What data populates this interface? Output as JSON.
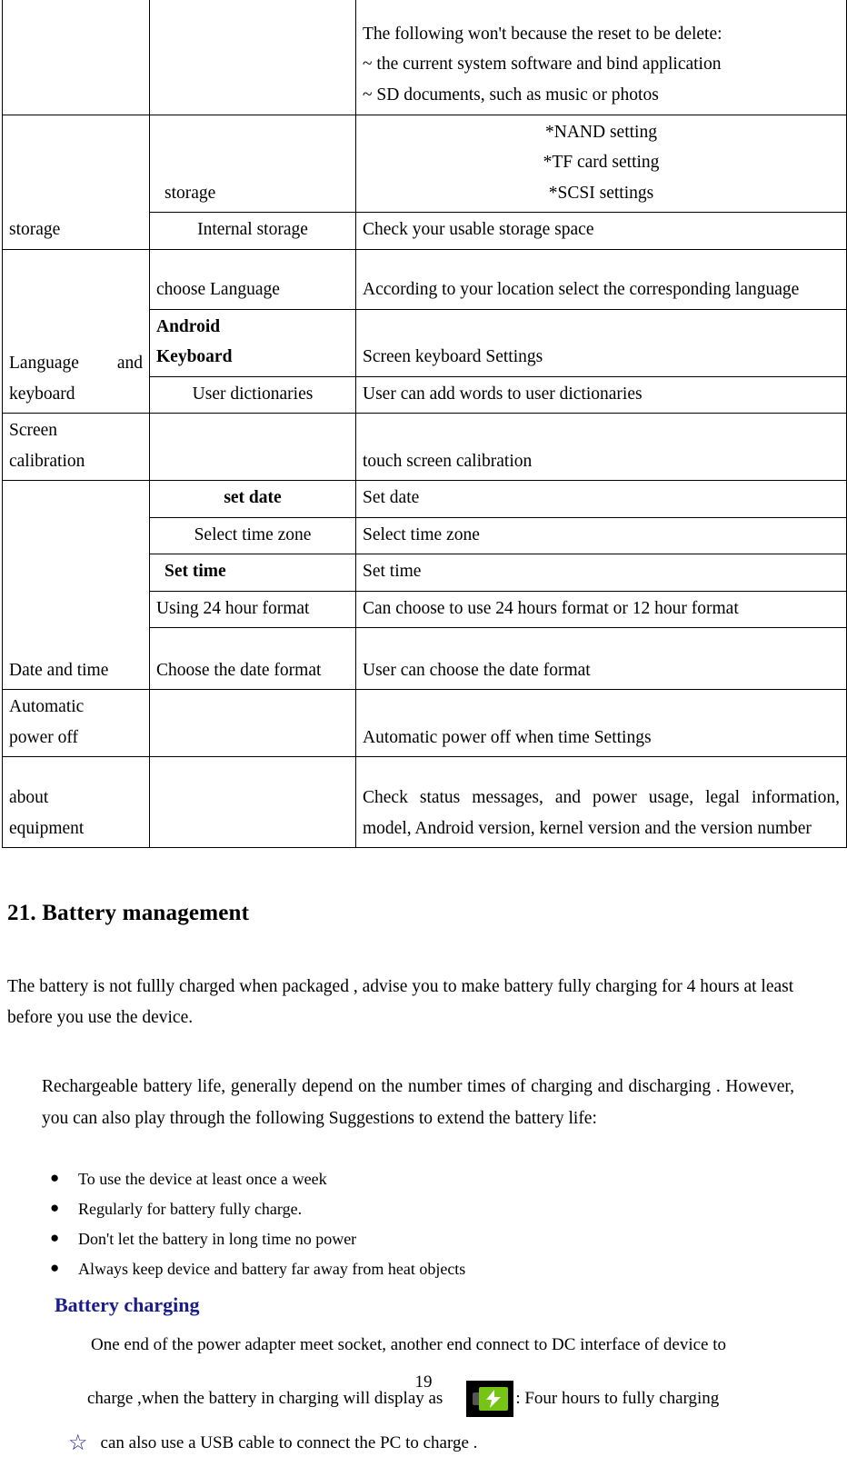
{
  "document": {
    "page_number": "19",
    "colors": {
      "heading_blue": "#1b1b8f",
      "battery_green": "#76c413",
      "text_black": "#000000"
    }
  },
  "settings_table": {
    "rows": [
      {
        "feature": "",
        "option": "",
        "description_lines": [
          "The following won't because the reset to be delete:",
          "~ the current system software and bind application",
          "~ SD documents, such as music or photos"
        ]
      },
      {
        "feature": "storage",
        "option": "storage",
        "description_lines": [
          "*NAND setting",
          "*TF card setting",
          "*SCSI settings"
        ]
      },
      {
        "feature": "",
        "option": "Internal storage",
        "description_lines": [
          "Check your usable storage space"
        ]
      },
      {
        "feature": "Language and keyboard",
        "option": "choose Language",
        "description_lines": [
          "According to your location select the corresponding language"
        ]
      },
      {
        "feature": "",
        "option": "Android Keyboard",
        "option_line_1": "Android",
        "option_line_2": "Keyboard",
        "description_lines": [
          "Screen keyboard Settings"
        ]
      },
      {
        "feature": "",
        "option": "User dictionaries",
        "description_lines": [
          "User can add words to user dictionaries"
        ]
      },
      {
        "feature": "Screen calibration",
        "feature_line_1": "Screen",
        "feature_line_2": "calibration",
        "option": "",
        "description_lines": [
          "touch screen calibration"
        ]
      },
      {
        "feature": "Date and time",
        "option": "set date",
        "description_lines": [
          "Set date"
        ]
      },
      {
        "feature": "",
        "option": "Select time zone",
        "description_lines": [
          "Select time zone"
        ]
      },
      {
        "feature": "",
        "option": "Set time",
        "description_lines": [
          "Set time"
        ]
      },
      {
        "feature": "",
        "option": "Using 24 hour format",
        "description_lines": [
          "Can choose to use 24 hours format or 12 hour format"
        ]
      },
      {
        "feature": "",
        "option": "Choose the date format",
        "description_lines": [
          "User can choose the date format"
        ]
      },
      {
        "feature": "Automatic power off",
        "feature_line_1": "Automatic",
        "feature_line_2": "power off",
        "option": "",
        "description_lines": [
          "Automatic power off when time Settings"
        ]
      },
      {
        "feature": "about equipment",
        "feature_line_1": "about",
        "feature_line_2": "equipment",
        "option": "",
        "description_lines": [
          "Check status messages, and power usage, legal information, model, Android version, kernel version and the version number"
        ]
      }
    ],
    "cells": {
      "r1_desc_l1": "The following won't because the reset to be delete:",
      "r1_desc_l2": "~ the current system software and bind application",
      "r1_desc_l3": "~ SD documents, such as music or photos",
      "r2_feature": "storage",
      "r2_option": "storage",
      "r2_desc_l1": "*NAND setting",
      "r2_desc_l2": "*TF card setting",
      "r2_desc_l3": "*SCSI settings",
      "r3_option": "Internal storage",
      "r3_desc": "Check your usable storage space",
      "r4_feature": "Language  and keyboard",
      "r4_option": "choose Language",
      "r4_desc": "According to your location select the corresponding language",
      "r5_option_l1": "Android",
      "r5_option_l2": "Keyboard",
      "r5_desc": "Screen keyboard Settings",
      "r6_option": "User dictionaries",
      "r6_desc": "User can add words to user dictionaries",
      "r7_feature_l1": "Screen",
      "r7_feature_l2": "calibration",
      "r7_desc": "touch screen calibration",
      "r8_feature": "Date and time",
      "r8_option": "set date",
      "r8_desc": "Set date",
      "r9_option": "Select time zone",
      "r9_desc": "Select time zone",
      "r10_option": "Set time",
      "r10_desc": "Set time",
      "r11_option": "Using 24 hour format",
      "r11_desc": "Can choose to use 24 hours format or 12 hour format",
      "r12_option": "Choose the date format",
      "r12_desc": "User can choose the date format",
      "r13_feature_l1": "Automatic",
      "r13_feature_l2": "power off",
      "r13_desc": "Automatic power off when time Settings",
      "r14_feature_l1": "about",
      "r14_feature_l2": "equipment",
      "r14_desc": "Check status messages, and power usage, legal information, model, Android version, kernel version and the version number"
    }
  },
  "battery_section": {
    "heading": "21. Battery management",
    "intro_paragraph": "The battery    is not fullly charged when packaged , advise you to make battery fully charging for 4 hours at least before you use the device.",
    "body_paragraph": "Rechargeable battery life, generally depend on the number times of charging and discharging . However, you can also play through the following Suggestions to    extend    the battery life:",
    "tips": [
      "To use the device at least once a week",
      "Regularly for battery fully charge.",
      "Don't let the battery in long time no power",
      "Always keep device and battery far away from heat objects"
    ],
    "bullet_glyph": "●",
    "charging": {
      "sub_heading": "Battery charging",
      "line_1": "One end of the power adapter meet socket, another end connect to DC interface of device to",
      "line_2_before_icon": "charge ,when the battery in charging will display as",
      "icon_name": "battery-charging-icon",
      "line_2_after_icon": ": Four hours to fully charging",
      "star_glyph": "☆",
      "star_note": "can also use a USB cable to connect the PC to charge ."
    }
  }
}
